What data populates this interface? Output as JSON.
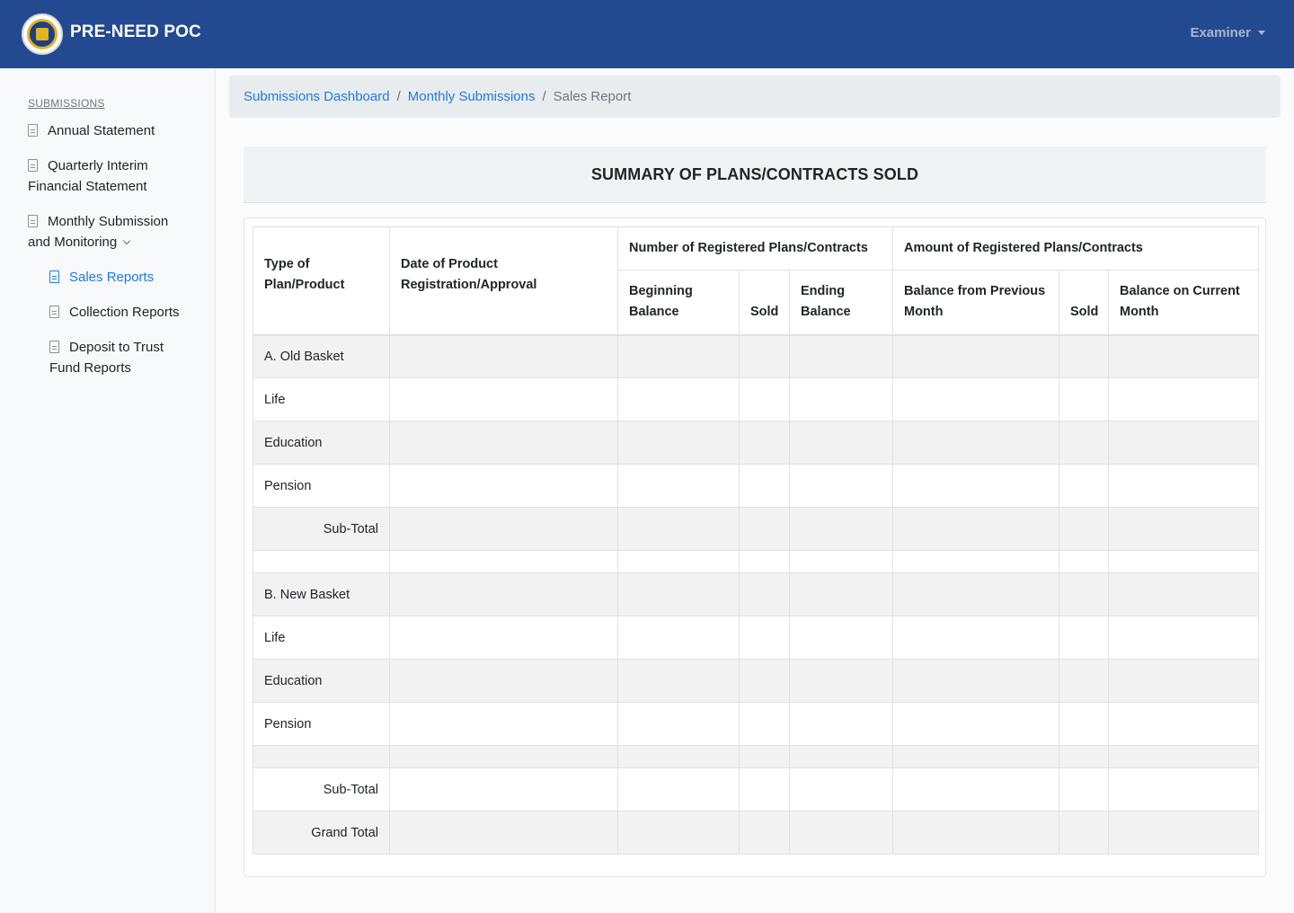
{
  "app": {
    "brand": "PRE-NEED POC",
    "user_menu": "Examiner"
  },
  "sidebar": {
    "heading": "SUBMISSIONS",
    "items": [
      {
        "label": "Annual Statement"
      },
      {
        "label_line1": "Quarterly Interim",
        "label_line2": "Financial Statement"
      },
      {
        "label_line1": "Monthly Submission",
        "label_line2": "and Monitoring"
      }
    ],
    "subitems": [
      {
        "label": "Sales Reports"
      },
      {
        "label": "Collection Reports"
      },
      {
        "label_line1": "Deposit to Trust",
        "label_line2": "Fund Reports"
      }
    ]
  },
  "breadcrumb": {
    "items": [
      "Submissions Dashboard",
      "Monthly Submissions"
    ],
    "current": "Sales Report",
    "separator": "/"
  },
  "report": {
    "title": "SUMMARY OF PLANS/CONTRACTS SOLD",
    "group_headers": [
      "Number of Registered Plans/Contracts",
      "Amount of Registered Plans/Contracts"
    ],
    "columns": [
      {
        "line1": "Type of",
        "line2": "Plan/Product"
      },
      {
        "line1": "Date of Product",
        "line2": "Registration/Approval"
      },
      {
        "line1": "Beginning",
        "line2": "Balance"
      },
      {
        "line1": "",
        "line2": "Sold"
      },
      {
        "line1": "Ending",
        "line2": "Balance"
      },
      {
        "line1": "Balance from Previous",
        "line2": "Month"
      },
      {
        "line1": "",
        "line2": "Sold"
      },
      {
        "line1": "Balance on Current",
        "line2": "Month"
      }
    ],
    "rows": [
      "A. Old Basket",
      "Life",
      "Education",
      "Pension",
      "Sub-Total",
      "",
      "B. New Basket",
      "Life",
      "Education",
      "Pension",
      "",
      "Sub-Total",
      "Grand Total"
    ]
  }
}
